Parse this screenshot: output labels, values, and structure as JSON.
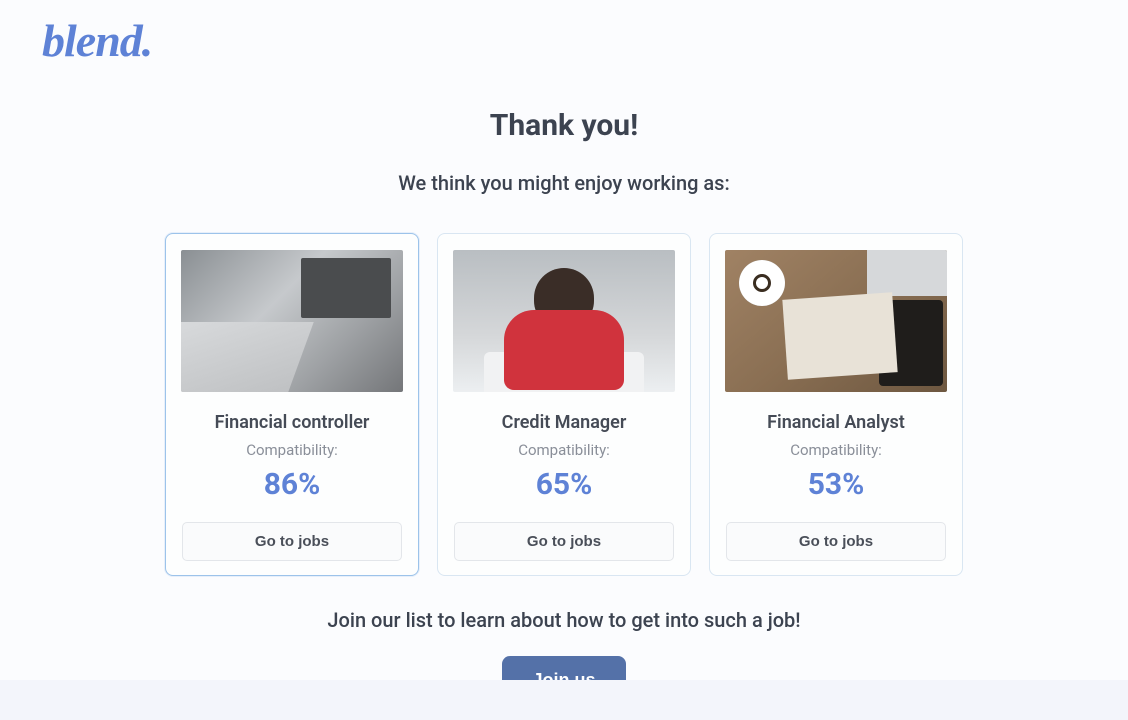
{
  "brand": {
    "logo_text": "blend."
  },
  "header": {
    "title": "Thank you!",
    "subtitle": "We think you might enjoy working as:"
  },
  "compat_label": "Compatibility:",
  "go_label": "Go to jobs",
  "cards": [
    {
      "title": "Financial controller",
      "compat": "86%",
      "selected": true,
      "image_alt": "laptops-and-paperwork"
    },
    {
      "title": "Credit Manager",
      "compat": "65%",
      "selected": false,
      "image_alt": "woman-at-laptop"
    },
    {
      "title": "Financial Analyst",
      "compat": "53%",
      "selected": false,
      "image_alt": "desk-flatlay"
    }
  ],
  "cta": {
    "join_text": "Join our list to learn about how to get into such a job!",
    "join_button": "Join us"
  },
  "colors": {
    "accent": "#5e82d6",
    "cta_bg": "#5471a8"
  }
}
